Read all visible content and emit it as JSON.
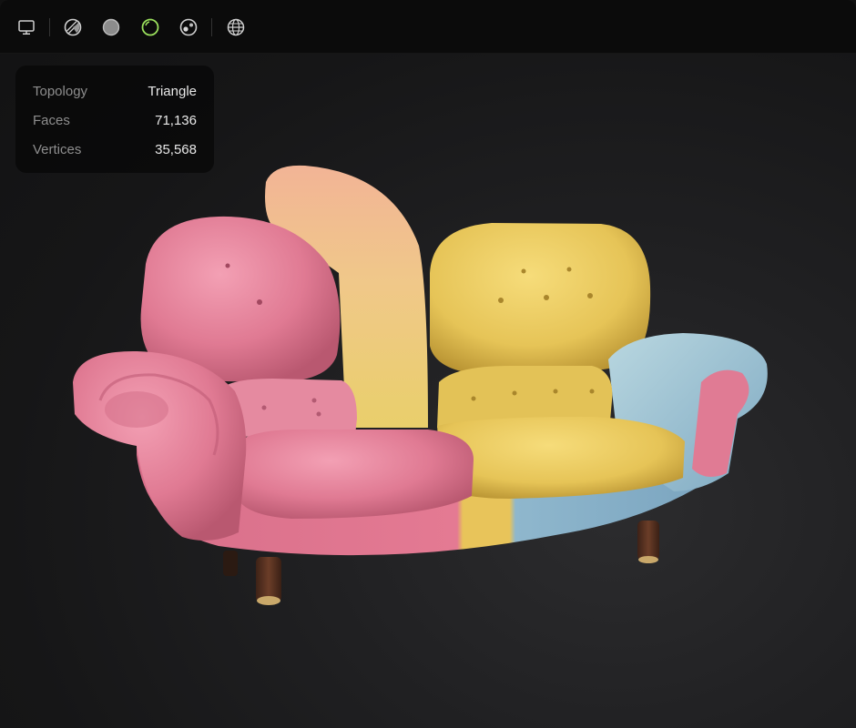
{
  "toolbar": {
    "buttons": [
      {
        "icon": "monitor-icon",
        "state": "inactive"
      },
      {
        "icon": "wireframe-sphere-icon",
        "state": "inactive"
      },
      {
        "icon": "solid-sphere-icon",
        "state": "inactive"
      },
      {
        "icon": "outline-sphere-icon",
        "state": "active",
        "color": "#9be15d"
      },
      {
        "icon": "textured-sphere-icon",
        "state": "inactive"
      },
      {
        "icon": "globe-grid-icon",
        "state": "inactive"
      }
    ]
  },
  "stats": {
    "rows": [
      {
        "label": "Topology",
        "value": "Triangle"
      },
      {
        "label": "Faces",
        "value": "71,136"
      },
      {
        "label": "Vertices",
        "value": "35,568"
      }
    ]
  },
  "viewport": {
    "model": "patchwork velvet sofa (pink, yellow, blue)",
    "colors": {
      "pink": "#e57f98",
      "yellow": "#e8c65a",
      "blue": "#8fb8cf",
      "leg": "#5a3524"
    }
  }
}
